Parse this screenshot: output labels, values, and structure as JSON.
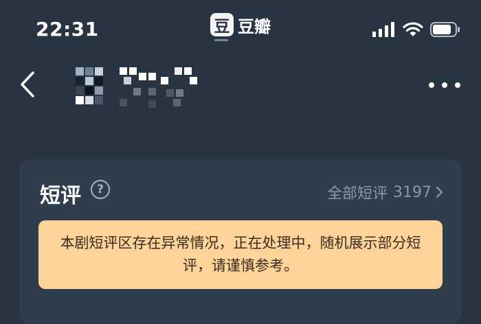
{
  "status_bar": {
    "time": "22:31",
    "app_badge": {
      "logo_char": "豆",
      "name": "豆瓣"
    },
    "icons": [
      "cellular-signal-icon",
      "wifi-icon",
      "battery-icon"
    ]
  },
  "nav": {
    "back_icon": "chevron-left-icon",
    "title": "",
    "more_icon": "more-horizontal-icon"
  },
  "reviews": {
    "title": "短评",
    "help_glyph": "?",
    "all_label": "全部短评",
    "all_count": "3197",
    "notice": "本剧短评区存在异常情况，正在处理中，随机展示部分短评，请谨慎参考。"
  },
  "colors": {
    "background": "#283442",
    "card": "#303d4c",
    "notice_bg": "#fdd39a",
    "notice_text": "#3a2d1e",
    "muted_text": "#8d98a5"
  }
}
